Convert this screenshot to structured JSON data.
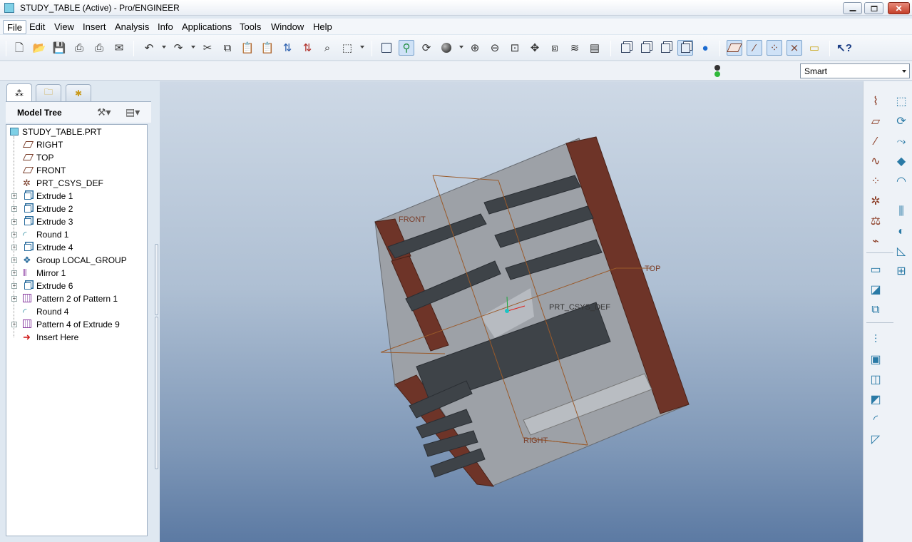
{
  "window": {
    "title": "STUDY_TABLE (Active) - Pro/ENGINEER"
  },
  "menu": [
    "File",
    "Edit",
    "View",
    "Insert",
    "Analysis",
    "Info",
    "Applications",
    "Tools",
    "Window",
    "Help"
  ],
  "filter": {
    "selected": "Smart"
  },
  "navigator": {
    "title": "Model Tree",
    "tree": [
      {
        "label": "STUDY_TABLE.PRT",
        "icon": "part-icon",
        "expander": false
      },
      {
        "label": "RIGHT",
        "icon": "datum-plane-icon",
        "expander": false
      },
      {
        "label": "TOP",
        "icon": "datum-plane-icon",
        "expander": false
      },
      {
        "label": "FRONT",
        "icon": "datum-plane-icon",
        "expander": false
      },
      {
        "label": "PRT_CSYS_DEF",
        "icon": "coordinate-system-icon",
        "expander": false
      },
      {
        "label": "Extrude 1",
        "icon": "extrude-icon",
        "expander": true
      },
      {
        "label": "Extrude 2",
        "icon": "extrude-icon",
        "expander": true
      },
      {
        "label": "Extrude 3",
        "icon": "extrude-icon",
        "expander": true
      },
      {
        "label": "Round 1",
        "icon": "round-icon",
        "expander": true
      },
      {
        "label": "Extrude 4",
        "icon": "extrude-icon",
        "expander": true
      },
      {
        "label": "Group LOCAL_GROUP",
        "icon": "group-icon",
        "expander": true
      },
      {
        "label": "Mirror 1",
        "icon": "mirror-icon",
        "expander": true
      },
      {
        "label": "Extrude 6",
        "icon": "extrude-icon",
        "expander": true
      },
      {
        "label": "Pattern 2 of Pattern 1",
        "icon": "pattern-icon",
        "expander": true
      },
      {
        "label": "Round 4",
        "icon": "round-icon",
        "expander": false
      },
      {
        "label": "Pattern 4 of Extrude 9",
        "icon": "pattern-icon",
        "expander": true
      },
      {
        "label": "Insert Here",
        "icon": "insert-arrow-icon",
        "expander": false
      }
    ]
  },
  "viewport": {
    "labels": {
      "front": "FRONT",
      "top": "TOP",
      "right": "RIGHT",
      "csys": "PRT_CSYS_DEF"
    },
    "colors": {
      "body": "#8c8f95",
      "shelf": "#a4a8ae",
      "slot": "#3e4348",
      "cut_face": "#6e3428",
      "datum": "#9a5a2a"
    }
  }
}
